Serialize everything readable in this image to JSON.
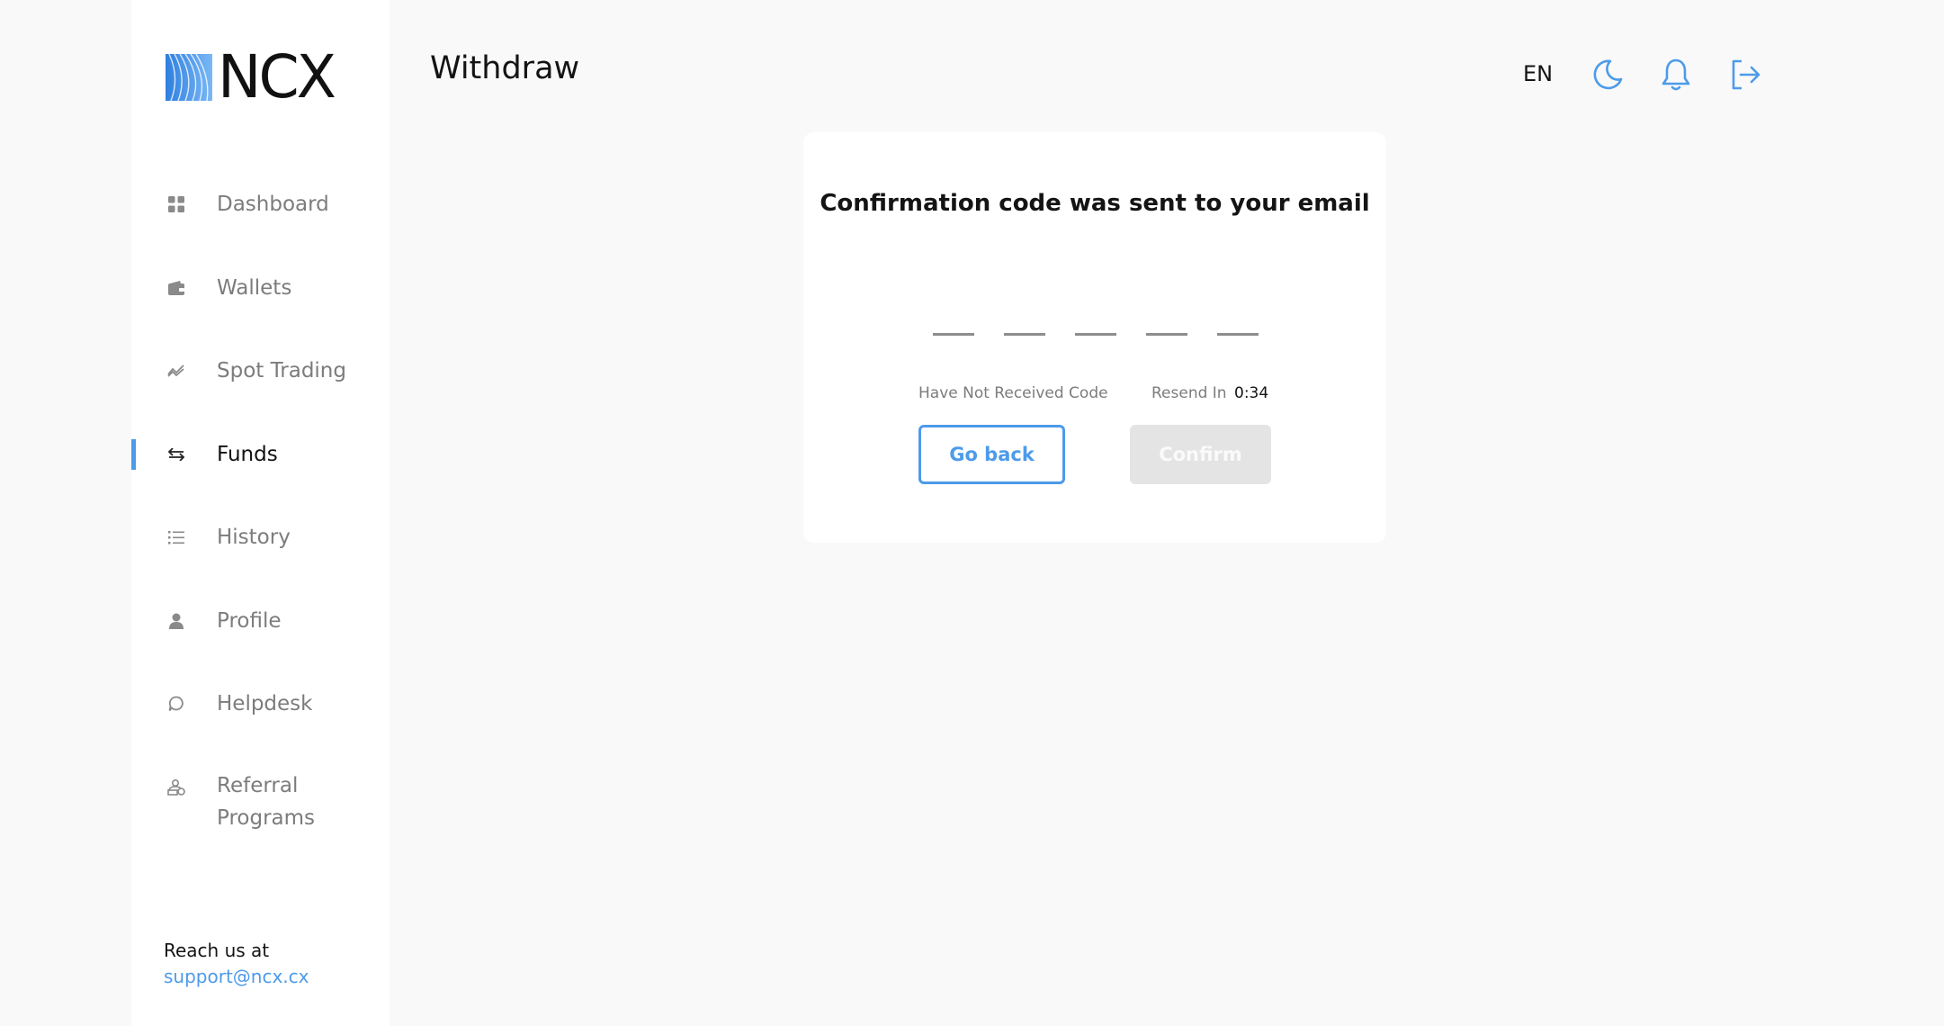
{
  "brand": {
    "name": "NCX"
  },
  "sidebar": {
    "items": [
      {
        "label": "Dashboard",
        "icon": "grid-icon",
        "active": false
      },
      {
        "label": "Wallets",
        "icon": "wallet-icon",
        "active": false
      },
      {
        "label": "Spot Trading",
        "icon": "trend-icon",
        "active": false
      },
      {
        "label": "Funds",
        "icon": "transfer-arrows-icon",
        "active": true
      },
      {
        "label": "History",
        "icon": "list-icon",
        "active": false
      },
      {
        "label": "Profile",
        "icon": "user-icon",
        "active": false
      },
      {
        "label": "Helpdesk",
        "icon": "chat-bubble-icon",
        "active": false
      },
      {
        "label": "Referral Programs",
        "icon": "referral-icon",
        "active": false
      }
    ],
    "footer": {
      "label": "Reach us at",
      "email": "support@ncx.cx"
    }
  },
  "header": {
    "title": "Withdraw",
    "language": "EN",
    "icons": [
      "moon-icon",
      "bell-icon",
      "logout-icon"
    ]
  },
  "confirmation": {
    "title": "Confirmation code was sent to your email",
    "code_length": 5,
    "not_received_label": "Have Not Received Code",
    "resend_label": "Resend In",
    "timer": "0:34",
    "go_back_label": "Go back",
    "confirm_label": "Confirm"
  },
  "colors": {
    "accent": "#4d9be9",
    "text": "#141414",
    "muted": "#7c7c7c",
    "disabled_button": "#e4e4e4",
    "background": "#f9f9f9"
  }
}
